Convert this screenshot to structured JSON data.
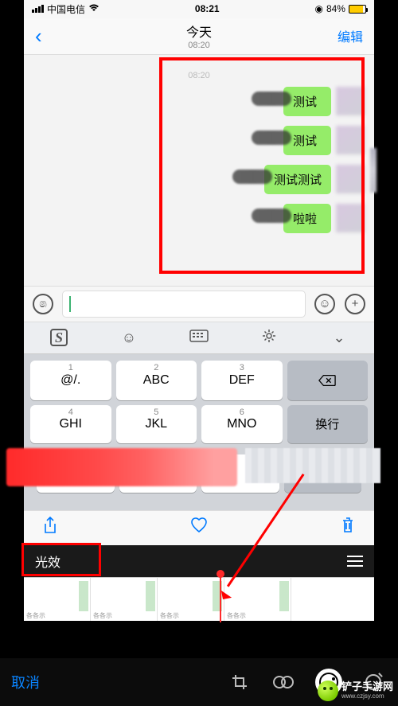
{
  "status": {
    "carrier": "中国电信",
    "time": "08:21",
    "battery_pct": "84%",
    "battery_icon_state": "charging-yellow"
  },
  "nav": {
    "back_icon": "chevron-left",
    "title": "今天",
    "subtitle": "08:20",
    "edit_label": "编辑"
  },
  "chat": {
    "timestamp": "08:20",
    "messages": [
      {
        "text": "测试"
      },
      {
        "text": "测试"
      },
      {
        "text": "测试测试"
      },
      {
        "text": "啦啦"
      }
    ]
  },
  "input_bar": {
    "voice_icon": "voice-wave",
    "emoji_icon": "smiley",
    "plus_icon": "plus-circle",
    "input_value": ""
  },
  "keyboard": {
    "top_icons": [
      "sogou-logo",
      "smiley",
      "keyboard",
      "gear",
      "chevron-down"
    ],
    "rows": [
      [
        {
          "main": "@/.",
          "num": "1"
        },
        {
          "main": "ABC",
          "num": "2"
        },
        {
          "main": "DEF",
          "num": "3"
        },
        {
          "main": "⌫",
          "num": "",
          "gray": true,
          "type": "delete"
        }
      ],
      [
        {
          "main": "GHI",
          "num": "4"
        },
        {
          "main": "JKL",
          "num": "5"
        },
        {
          "main": "MNO",
          "num": "6"
        },
        {
          "main": "换行",
          "num": "",
          "gray": true,
          "type": "return"
        }
      ]
    ]
  },
  "photo_actions": {
    "share_icon": "share",
    "heart_icon": "heart-outline",
    "trash_icon": "trash"
  },
  "edit_bar": {
    "title": "光效",
    "menu_icon": "menu-lines"
  },
  "thumbnails": {
    "count": 4,
    "label_stub": "各各示"
  },
  "bottom_toolbar": {
    "cancel": "取消",
    "tools": [
      "crop",
      "color-filters",
      "adjust-dial",
      "magic-wand"
    ],
    "active_index": 2
  },
  "annotation": {
    "box1_target": "chat-messages",
    "box2_target": "edit-title",
    "arrow_from": "edit_bar",
    "arrow_to": "thumbnail-playhead"
  },
  "watermark": {
    "name": "铲子手游网",
    "url": "www.czjsy.com"
  }
}
